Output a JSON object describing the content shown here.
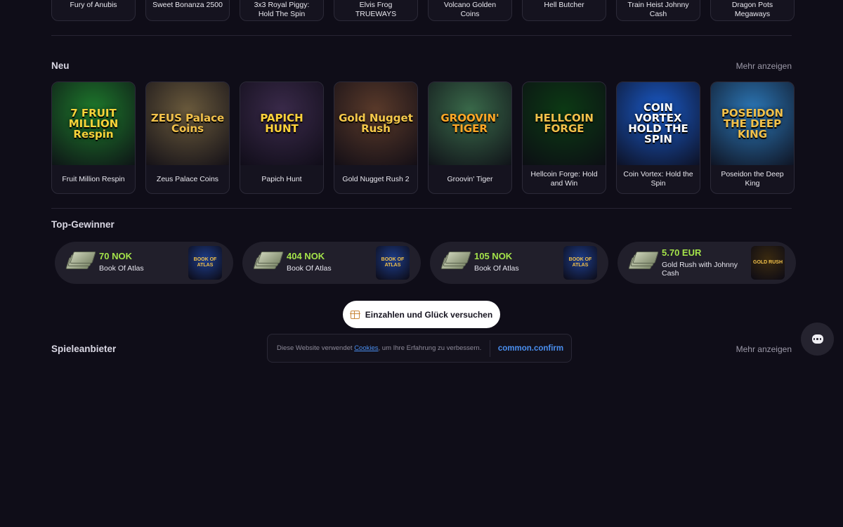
{
  "top_row": [
    {
      "title": "Fury of Anubis"
    },
    {
      "title": "Sweet Bonanza 2500"
    },
    {
      "title": "3x3 Royal Piggy: Hold The Spin"
    },
    {
      "title": "Elvis Frog TRUEWAYS"
    },
    {
      "title": "Volcano Golden Coins"
    },
    {
      "title": "Hell Butcher"
    },
    {
      "title": "Train Heist Johnny Cash"
    },
    {
      "title": "Dragon Pots Megaways"
    }
  ],
  "new_section": {
    "title": "Neu",
    "more_label": "Mehr anzeigen",
    "games": [
      {
        "title": "Fruit Million Respin",
        "art": "7 FRUIT MILLION Respin",
        "bg": "#1e7a2c",
        "fg": "#f6d33a"
      },
      {
        "title": "Zeus Palace Coins",
        "art": "ZEUS Palace Coins",
        "bg": "#6a5a3c",
        "fg": "#f2c14a"
      },
      {
        "title": "Papich Hunt",
        "art": "PAPICH HUNT",
        "bg": "#3a2a4a",
        "fg": "#ffd23a"
      },
      {
        "title": "Gold Nugget Rush 2",
        "art": "Gold Nugget Rush",
        "bg": "#5a3a2a",
        "fg": "#f5c84a"
      },
      {
        "title": "Groovin' Tiger",
        "art": "GROOVIN' TIGER",
        "bg": "#3a6a4a",
        "fg": "#ffa726"
      },
      {
        "title": "Hellcoin Forge: Hold and Win",
        "art": "HELLCOIN FORGE",
        "bg": "#0c3a14",
        "fg": "#f2c14a"
      },
      {
        "title": "Coin Vortex: Hold the Spin",
        "art": "COIN VORTEX HOLD THE SPIN",
        "bg": "#1a5ac8",
        "fg": "#ffffff"
      },
      {
        "title": "Poseidon the Deep King",
        "art": "POSEIDON THE DEEP KING",
        "bg": "#2c78b8",
        "fg": "#f2c14a"
      }
    ]
  },
  "winners_section": {
    "title": "Top-Gewinner",
    "items": [
      {
        "amount": "70 NOK",
        "game": "Book Of Atlas",
        "art": "BOOK OF ATLAS",
        "bg": "#1d3d8a"
      },
      {
        "amount": "404 NOK",
        "game": "Book Of Atlas",
        "art": "BOOK OF ATLAS",
        "bg": "#1d3d8a"
      },
      {
        "amount": "105 NOK",
        "game": "Book Of Atlas",
        "art": "BOOK OF ATLAS",
        "bg": "#1d3d8a"
      },
      {
        "amount": "5.70 EUR",
        "game": "Gold Rush with Johnny Cash",
        "art": "GOLD RUSH",
        "bg": "#3a2a10"
      }
    ]
  },
  "cta": {
    "label": "Einzahlen und Glück versuchen",
    "icon": "gift-icon"
  },
  "providers_section": {
    "title": "Spieleanbieter",
    "more_label": "Mehr anzeigen"
  },
  "cookie_banner": {
    "text_before": "Diese Website verwendet ",
    "link": "Cookies",
    "text_after": ", um Ihre Erfahrung zu verbessern.",
    "confirm_label": "common.confirm"
  },
  "chat": {
    "icon": "chat-bubble-icon"
  },
  "colors": {
    "background": "#0f0d18",
    "accent_green": "#a4e34a",
    "link_blue": "#4a8ff0"
  }
}
